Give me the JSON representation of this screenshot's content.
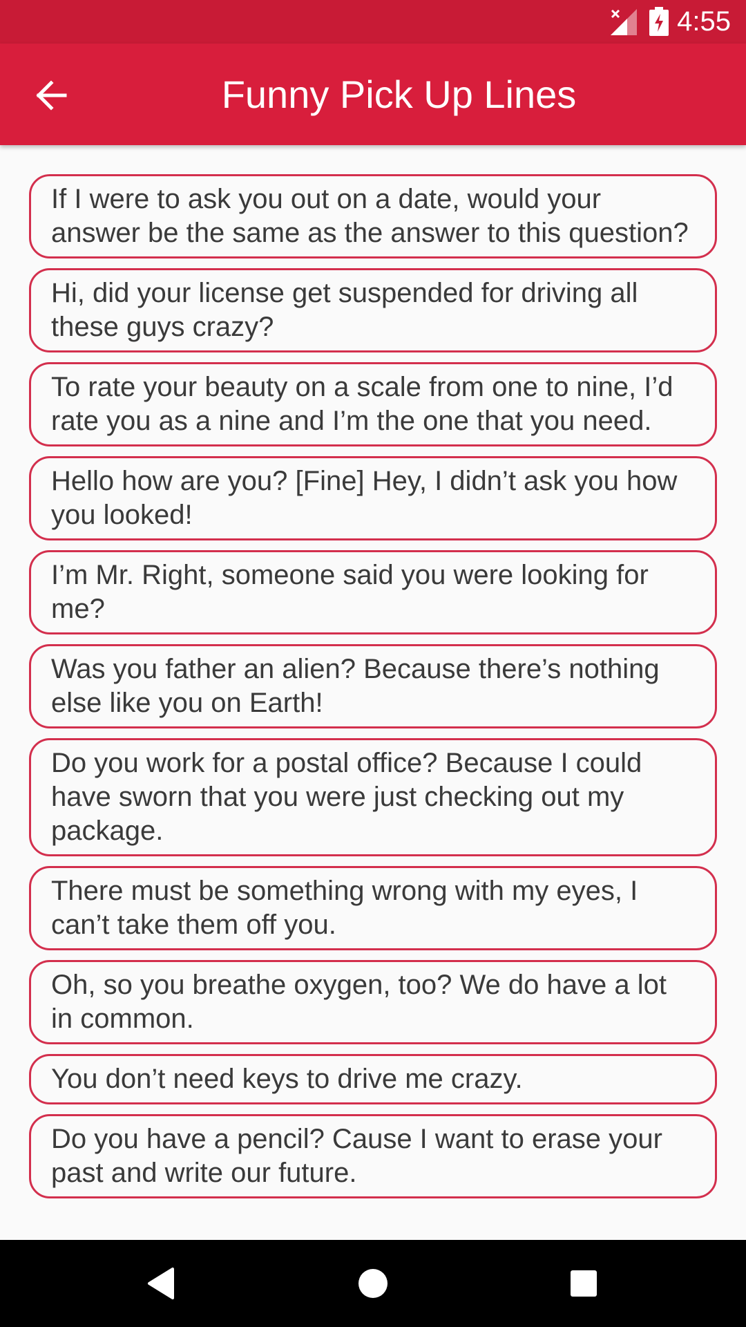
{
  "status_bar": {
    "time": "4:55",
    "icons": [
      "signal-no-data-icon",
      "battery-charging-icon"
    ]
  },
  "app_bar": {
    "title": "Funny Pick Up Lines",
    "back_icon": "arrow-back-icon"
  },
  "lines": [
    "If I were to ask you out on a date, would your answer be the same as the answer to this question?",
    "Hi, did your license get suspended for driving all these guys crazy?",
    "To rate your beauty on a scale from one to nine, I’d rate you as a nine and I’m the one that you need.",
    "Hello how are you? [Fine] Hey, I didn’t ask you how you looked!",
    "I’m Mr. Right, someone said you were looking for me?",
    "Was you father an alien? Because there’s nothing else like you on Earth!",
    "Do you work for a postal office? Because I could have sworn that you were just checking out my package.",
    "There must be something wrong with my eyes, I can’t take them off you.",
    "Oh, so you breathe oxygen, too? We do have a lot in common.",
    "You don’t need keys to drive me crazy.",
    "Do you have a pencil? Cause I want to erase your past and write our future."
  ],
  "nav_bar": {
    "icons": [
      "back-triangle-icon",
      "home-circle-icon",
      "recents-square-icon"
    ]
  },
  "colors": {
    "status_bar": "#c81b36",
    "app_bar": "#d81e3c",
    "card_border": "#d32f4d",
    "background": "#fafafa"
  }
}
